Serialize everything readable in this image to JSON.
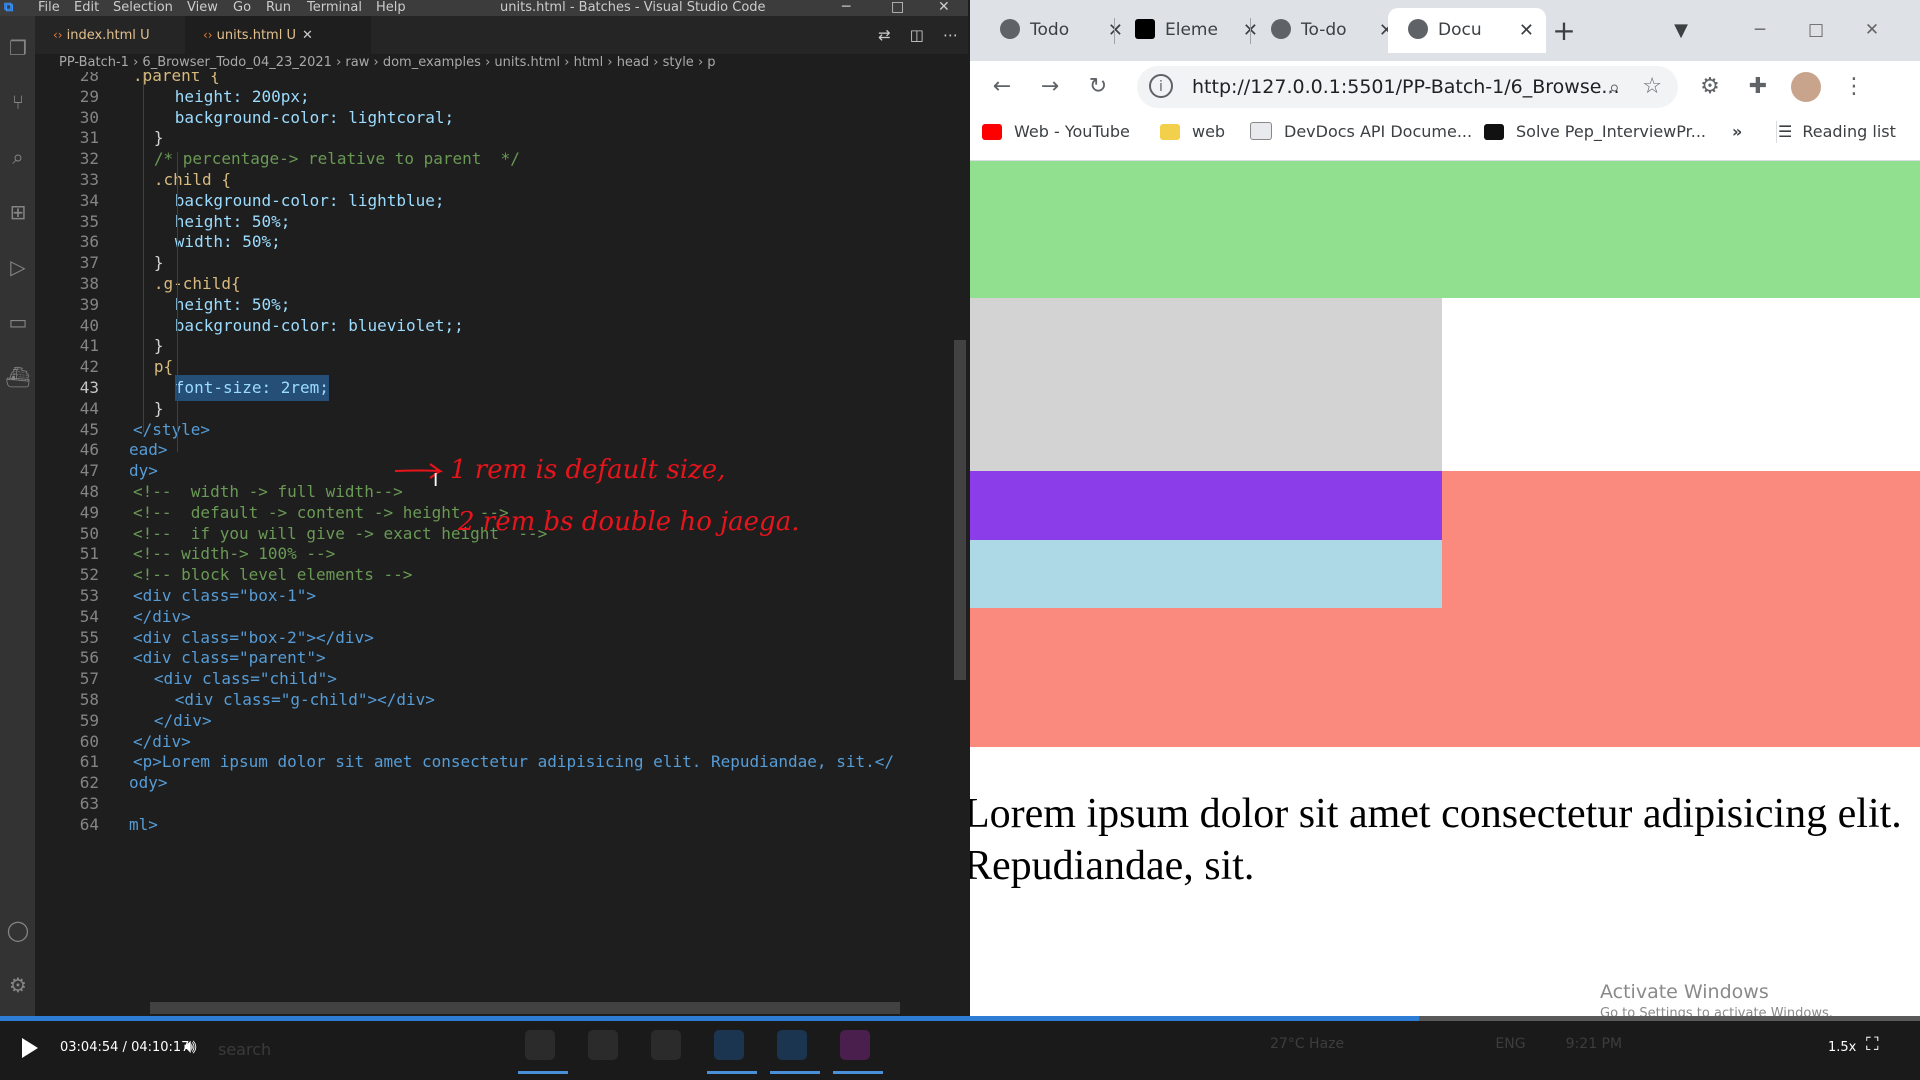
{
  "vscode": {
    "menu": [
      "File",
      "Edit",
      "Selection",
      "View",
      "Go",
      "Run",
      "Terminal",
      "Help"
    ],
    "window_title": "units.html - Batches - Visual Studio Code",
    "tabs": [
      {
        "label": "index.html",
        "status": "U"
      },
      {
        "label": "units.html",
        "status": "U",
        "close": "✕"
      }
    ],
    "breadcrumb": [
      "PP-Batch-1",
      "6_Browser_Todo_04_23_2021",
      "raw",
      "dom_examples",
      "units.html",
      "html",
      "head",
      "style",
      "p"
    ],
    "lines": [
      {
        "n": "28",
        "code": ".parent {"
      },
      {
        "n": "29",
        "code": "height: 200px;"
      },
      {
        "n": "30",
        "code": "background-color: lightcoral;"
      },
      {
        "n": "31",
        "code": "}"
      },
      {
        "n": "32",
        "code": "/* percentage-> relative to parent  */"
      },
      {
        "n": "33",
        "code": ".child {"
      },
      {
        "n": "34",
        "code": "background-color: lightblue;"
      },
      {
        "n": "35",
        "code": "height: 50%;"
      },
      {
        "n": "36",
        "code": "width: 50%;"
      },
      {
        "n": "37",
        "code": "}"
      },
      {
        "n": "38",
        "code": ".g-child{"
      },
      {
        "n": "39",
        "code": "height: 50%;"
      },
      {
        "n": "40",
        "code": "background-color: blueviolet;;"
      },
      {
        "n": "41",
        "code": "}"
      },
      {
        "n": "42",
        "code": "p{"
      },
      {
        "n": "43",
        "code": "font-size: 2rem;"
      },
      {
        "n": "44",
        "code": "}"
      },
      {
        "n": "45",
        "code": "</style>"
      },
      {
        "n": "46",
        "code": "ead>"
      },
      {
        "n": "47",
        "code": "dy>"
      },
      {
        "n": "48",
        "code": "<!--  width -> full width-->"
      },
      {
        "n": "49",
        "code": "<!--  default -> content -> height  -->"
      },
      {
        "n": "50",
        "code": "<!--  if you will give -> exact height  -->"
      },
      {
        "n": "51",
        "code": "<!-- width-> 100% -->"
      },
      {
        "n": "52",
        "code": "<!-- block level elements -->"
      },
      {
        "n": "53",
        "code": "<div class=\"box-1\">"
      },
      {
        "n": "54",
        "code": "</div>"
      },
      {
        "n": "55",
        "code": "<div class=\"box-2\"></div>"
      },
      {
        "n": "56",
        "code": "<div class=\"parent\">"
      },
      {
        "n": "57",
        "code": "<div class=\"child\">"
      },
      {
        "n": "58",
        "code": "<div class=\"g-child\"></div>"
      },
      {
        "n": "59",
        "code": "</div>"
      },
      {
        "n": "60",
        "code": "</div>"
      },
      {
        "n": "61",
        "code": "<p>Lorem ipsum dolor sit amet consectetur adipisicing elit. Repudiandae, sit.</"
      },
      {
        "n": "62",
        "code": "ody>"
      },
      {
        "n": "63",
        "code": ""
      },
      {
        "n": "64",
        "code": "ml>"
      }
    ],
    "annotation": {
      "line1": "1 rem   is default size,",
      "line2": "2 rem   bs double ho jaega."
    },
    "colors": {
      "lightcoral": "#f08080",
      "lightblue": "#add8e6",
      "blueviolet": "#8a2be2"
    }
  },
  "chrome": {
    "tabs": [
      {
        "label": "Todo",
        "close": "✕"
      },
      {
        "label": "Eleme",
        "close": "✕"
      },
      {
        "label": "To-do",
        "close": "✕"
      },
      {
        "label": "Docu",
        "close": "✕"
      }
    ],
    "new_tab": "+",
    "url": "http://127.0.0.1:5501/PP-Batch-1/6_Browse...",
    "bookmarks": [
      "Web - YouTube",
      "web",
      "DevDocs API Docume...",
      "Solve Pep_InterviewPr..."
    ],
    "more_bookmarks": "»",
    "reading_list": "Reading list",
    "page": {
      "box1_color": "#90e090",
      "box2_color": "#d3d3d3",
      "parent_color": "#fa8a7e",
      "child_color": "#add8e6",
      "gchild_color": "#8a3de8",
      "paragraph": "Lorem ipsum dolor sit amet consectetur adipisicing elit. Repudiandae, sit."
    },
    "watermark": {
      "title": "Activate Windows",
      "subtitle": "Go to Settings to activate Windows."
    }
  },
  "player": {
    "current_time": "03:04:54",
    "separator": "/",
    "total_time": "04:10:17",
    "progress_fraction": 0.739,
    "speed": "1.5x",
    "taskbar_search": "search",
    "weather": "27°C  Haze",
    "lang": "ENG",
    "time": "9:21 PM"
  }
}
